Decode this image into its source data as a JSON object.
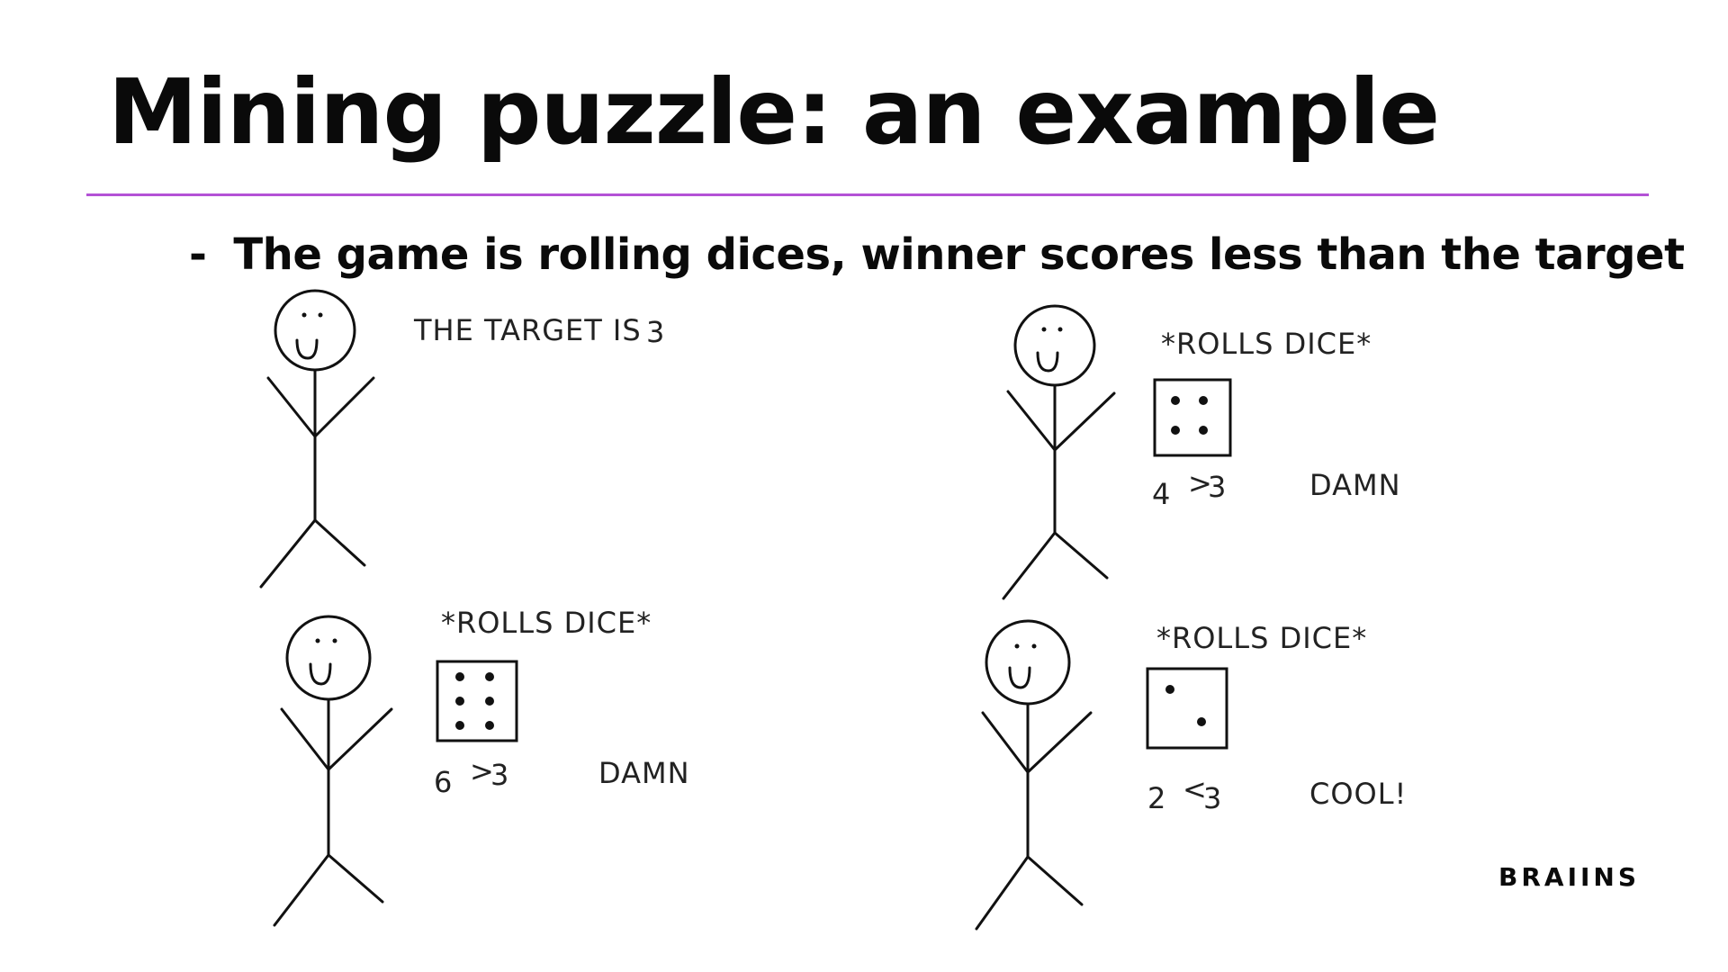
{
  "slide": {
    "title": "Mining puzzle: an example",
    "bullet_dash": "-",
    "bullet_text": "The game is rolling dices, winner scores less than the target"
  },
  "panels": [
    {
      "caption": "THE TARGET IS",
      "target": "3"
    },
    {
      "caption": "*ROLLS DICE*",
      "roll": "4",
      "comparator": ">",
      "target": "3",
      "reaction": "DAMN"
    },
    {
      "caption": "*ROLLS DICE*",
      "roll": "6",
      "comparator": ">",
      "target": "3",
      "reaction": "DAMN"
    },
    {
      "caption": "*ROLLS DICE*",
      "roll": "2",
      "comparator": "<",
      "target": "3",
      "reaction": "COOL!"
    }
  ],
  "brand": "BRAIINS",
  "colors": {
    "divider": "#b452d6",
    "roll_number": "#6fb3c9",
    "target_number": "#8a74d6"
  }
}
